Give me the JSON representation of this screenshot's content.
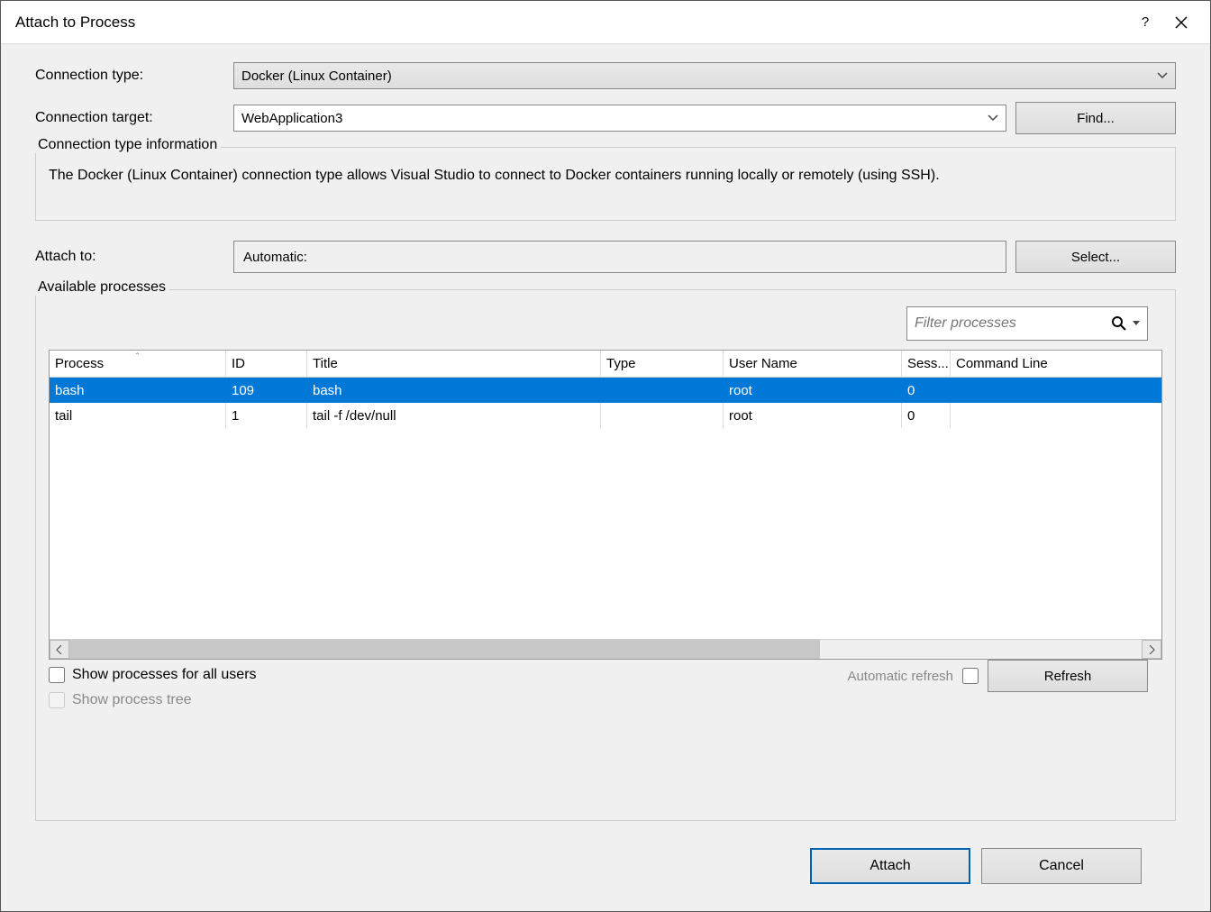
{
  "titlebar": {
    "title": "Attach to Process"
  },
  "form": {
    "connection_type_label": "Connection type:",
    "connection_type_value": "Docker (Linux Container)",
    "connection_target_label": "Connection target:",
    "connection_target_value": "WebApplication3",
    "find_label": "Find...",
    "info_title": "Connection type information",
    "info_body": "The Docker (Linux Container) connection type allows Visual Studio to connect to Docker containers running locally or remotely (using SSH).",
    "attach_to_label": "Attach to:",
    "attach_to_value": "Automatic:",
    "select_label": "Select..."
  },
  "processes": {
    "group_title": "Available processes",
    "filter_placeholder": "Filter processes",
    "columns": [
      "Process",
      "ID",
      "Title",
      "Type",
      "User Name",
      "Sess...",
      "Command Line"
    ],
    "rows": [
      {
        "process": "bash",
        "id": "109",
        "title": "bash",
        "type": "",
        "user": "root",
        "session": "0",
        "cmd": "",
        "selected": true
      },
      {
        "process": "tail",
        "id": "1",
        "title": "tail -f /dev/null",
        "type": "",
        "user": "root",
        "session": "0",
        "cmd": "",
        "selected": false
      }
    ],
    "show_all_users": "Show processes for all users",
    "show_tree": "Show process tree",
    "auto_refresh": "Automatic refresh",
    "refresh": "Refresh"
  },
  "footer": {
    "attach": "Attach",
    "cancel": "Cancel"
  }
}
